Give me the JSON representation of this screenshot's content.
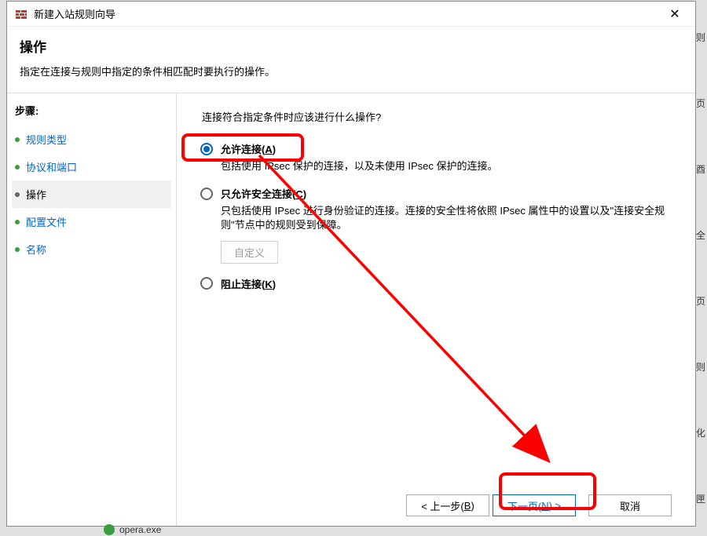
{
  "window": {
    "title": "新建入站规则向导",
    "close": "✕"
  },
  "header": {
    "title": "操作",
    "description": "指定在连接与规则中指定的条件相匹配时要执行的操作。"
  },
  "sidebar": {
    "heading": "步骤:",
    "items": [
      {
        "label": "规则类型",
        "state": "link"
      },
      {
        "label": "协议和端口",
        "state": "link"
      },
      {
        "label": "操作",
        "state": "current"
      },
      {
        "label": "配置文件",
        "state": "link"
      },
      {
        "label": "名称",
        "state": "link"
      }
    ]
  },
  "content": {
    "prompt": "连接符合指定条件时应该进行什么操作?",
    "options": [
      {
        "id": "allow",
        "label_prefix": "允许连接(",
        "label_key": "A",
        "label_suffix": ")",
        "description": "包括使用 IPsec 保护的连接，以及未使用 IPsec 保护的连接。",
        "selected": true
      },
      {
        "id": "secure",
        "label_prefix": "只允许安全连接(",
        "label_key": "C",
        "label_suffix": ")",
        "description": "只包括使用 IPsec 进行身份验证的连接。连接的安全性将依照 IPsec 属性中的设置以及\"连接安全规则\"节点中的规则受到保障。",
        "has_customize": true,
        "customize_label": "自定义",
        "selected": false
      },
      {
        "id": "block",
        "label_prefix": "阻止连接(",
        "label_key": "K",
        "label_suffix": ")",
        "description": "",
        "selected": false
      }
    ]
  },
  "footer": {
    "back_prefix": "< 上一步(",
    "back_key": "B",
    "back_suffix": ")",
    "next_prefix": "下一页(",
    "next_key": "N",
    "next_suffix": ") >",
    "cancel": "取消"
  },
  "taskbar_app": "opera.exe",
  "right_strip": [
    "则",
    "页",
    "酉",
    "全",
    "页",
    "则",
    "化",
    "匣"
  ],
  "annotation": {
    "boxes_visible": true,
    "arrow_visible": true
  }
}
